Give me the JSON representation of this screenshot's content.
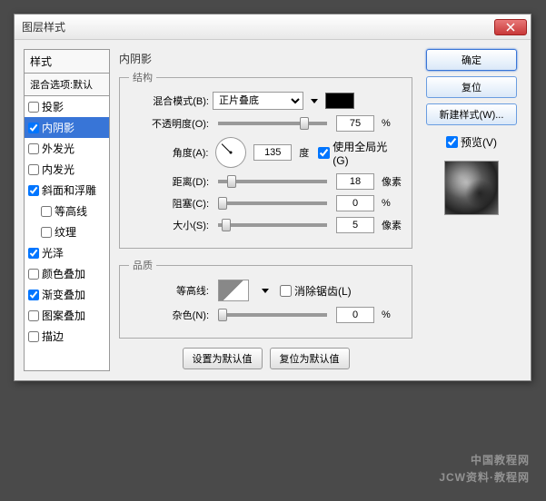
{
  "window": {
    "title": "图层样式"
  },
  "styles_panel": {
    "header": "样式",
    "blend_header": "混合选项:默认",
    "items": [
      {
        "label": "投影",
        "checked": false,
        "selected": false
      },
      {
        "label": "内阴影",
        "checked": true,
        "selected": true
      },
      {
        "label": "外发光",
        "checked": false,
        "selected": false
      },
      {
        "label": "内发光",
        "checked": false,
        "selected": false
      },
      {
        "label": "斜面和浮雕",
        "checked": true,
        "selected": false
      },
      {
        "label": "等高线",
        "checked": false,
        "selected": false,
        "indent": true
      },
      {
        "label": "纹理",
        "checked": false,
        "selected": false,
        "indent": true
      },
      {
        "label": "光泽",
        "checked": true,
        "selected": false
      },
      {
        "label": "颜色叠加",
        "checked": false,
        "selected": false
      },
      {
        "label": "渐变叠加",
        "checked": true,
        "selected": false
      },
      {
        "label": "图案叠加",
        "checked": false,
        "selected": false
      },
      {
        "label": "描边",
        "checked": false,
        "selected": false
      }
    ]
  },
  "center": {
    "title": "内阴影",
    "structure": {
      "legend": "结构",
      "blend_mode_label": "混合模式(B):",
      "blend_mode_value": "正片叠底",
      "color": "#000000",
      "opacity_label": "不透明度(O):",
      "opacity_value": "75",
      "opacity_unit": "%",
      "angle_label": "角度(A):",
      "angle_value": "135",
      "angle_unit": "度",
      "global_light_label": "使用全局光(G)",
      "global_light_checked": true,
      "distance_label": "距离(D):",
      "distance_value": "18",
      "distance_unit": "像素",
      "choke_label": "阻塞(C):",
      "choke_value": "0",
      "choke_unit": "%",
      "size_label": "大小(S):",
      "size_value": "5",
      "size_unit": "像素"
    },
    "quality": {
      "legend": "品质",
      "contour_label": "等高线:",
      "antialias_label": "消除锯齿(L)",
      "antialias_checked": false,
      "noise_label": "杂色(N):",
      "noise_value": "0",
      "noise_unit": "%"
    },
    "buttons": {
      "make_default": "设置为默认值",
      "reset_default": "复位为默认值"
    }
  },
  "right": {
    "ok": "确定",
    "reset": "复位",
    "new_style": "新建样式(W)...",
    "preview_label": "预览(V)",
    "preview_checked": true
  },
  "watermark": {
    "main": "中国教程网",
    "sub": "JCW资料·教程网"
  }
}
